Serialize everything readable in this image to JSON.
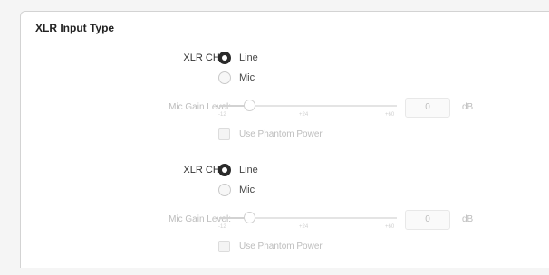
{
  "section": {
    "title": "XLR Input Type"
  },
  "channels": [
    {
      "label": "XLR CH 1:",
      "options": [
        {
          "label": "Line",
          "selected": true
        },
        {
          "label": "Mic",
          "selected": false
        }
      ],
      "gain": {
        "label": "Mic Gain Level:",
        "ticks": [
          "-12",
          "+24",
          "+60"
        ],
        "value": "0",
        "unit": "dB",
        "enabled": false,
        "level_fraction": 0.17
      },
      "phantom": {
        "label": "Use Phantom Power",
        "checked": false,
        "enabled": false
      }
    },
    {
      "label": "XLR CH 2:",
      "options": [
        {
          "label": "Line",
          "selected": true
        },
        {
          "label": "Mic",
          "selected": false
        }
      ],
      "gain": {
        "label": "Mic Gain Level:",
        "ticks": [
          "-12",
          "+24",
          "+60"
        ],
        "value": "0",
        "unit": "dB",
        "enabled": false,
        "level_fraction": 0.17
      },
      "phantom": {
        "label": "Use Phantom Power",
        "checked": false,
        "enabled": false
      }
    }
  ],
  "colors": {
    "selected_radio": "#2a2a2a",
    "disabled_text": "#bdbdbd",
    "panel_border": "#d3d3d3"
  }
}
